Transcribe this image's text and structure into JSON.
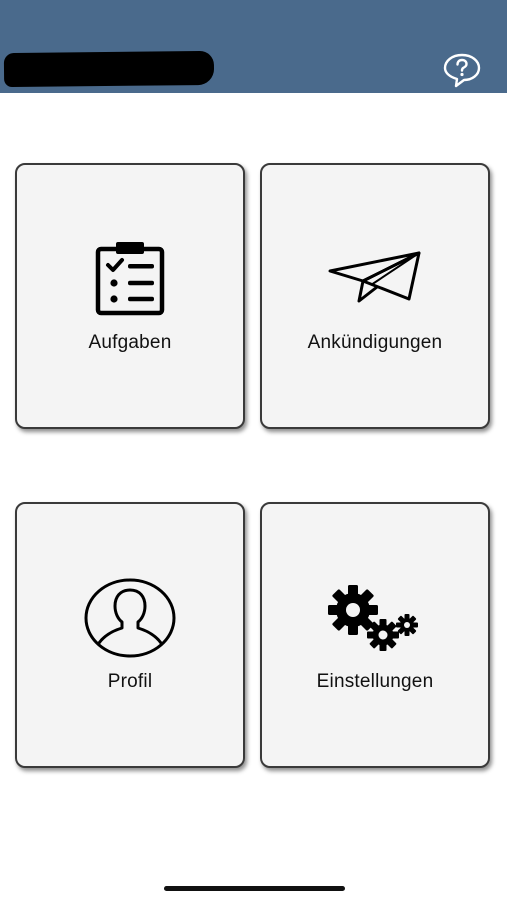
{
  "header": {
    "title": "",
    "help_icon": "help-bubble-icon",
    "background_color": "#4a6a8c"
  },
  "tiles": [
    {
      "label": "Aufgaben",
      "icon": "clipboard-checklist-icon"
    },
    {
      "label": "Ankündigungen",
      "icon": "paper-plane-icon"
    },
    {
      "label": "Profil",
      "icon": "user-profile-icon"
    },
    {
      "label": "Einstellungen",
      "icon": "gears-icon"
    }
  ]
}
